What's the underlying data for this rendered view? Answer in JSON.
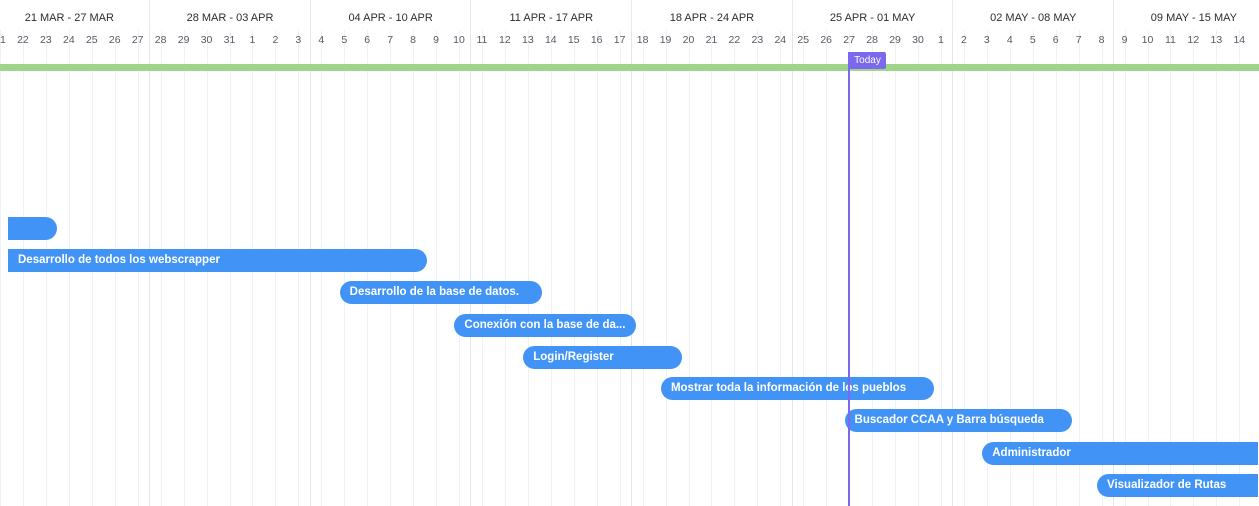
{
  "colors": {
    "task": "#4194f6",
    "today": "#7b68ee",
    "milestone_bar": "#9fd58a",
    "text": "#2a2e34"
  },
  "weeks": [
    "21 MAR - 27 MAR",
    "28 MAR - 03 APR",
    "04 APR - 10 APR",
    "11 APR - 17 APR",
    "18 APR - 24 APR",
    "25 APR - 01 MAY",
    "02 MAY - 08 MAY",
    "09 MAY - 15 MAY"
  ],
  "days": [
    "21",
    "22",
    "23",
    "24",
    "25",
    "26",
    "27",
    "28",
    "29",
    "30",
    "31",
    "1",
    "2",
    "3",
    "4",
    "5",
    "6",
    "7",
    "8",
    "9",
    "10",
    "11",
    "12",
    "13",
    "14",
    "15",
    "16",
    "17",
    "18",
    "19",
    "20",
    "21",
    "22",
    "23",
    "24",
    "25",
    "26",
    "27",
    "28",
    "29",
    "30",
    "1",
    "2",
    "3",
    "4",
    "5",
    "6",
    "7",
    "8",
    "9",
    "10",
    "11",
    "12",
    "13",
    "14"
  ],
  "today_label": "Today",
  "today_day_index": 37,
  "tasks": [
    {
      "label": "",
      "start": 0,
      "end": 2.5
    },
    {
      "label": "Desarrollo de todos los webscrapper",
      "start": 0,
      "end": 18.6
    },
    {
      "label": "Desarrollo de la base de datos.",
      "start": 14.8,
      "end": 23.6
    },
    {
      "label": "Conexión con la base de da...",
      "start": 19.8,
      "end": 27.7
    },
    {
      "label": "Login/Register",
      "start": 22.8,
      "end": 29.7
    },
    {
      "label": "Mostrar toda la información de los pueblos",
      "start": 28.8,
      "end": 40.7
    },
    {
      "label": "Buscador CCAA y Barra búsqueda",
      "start": 36.8,
      "end": 46.7
    },
    {
      "label": "Administrador",
      "start": 42.8,
      "end": 54.8
    },
    {
      "label": "Visualizador de Rutas",
      "start": 47.8,
      "end": 54.8
    }
  ]
}
